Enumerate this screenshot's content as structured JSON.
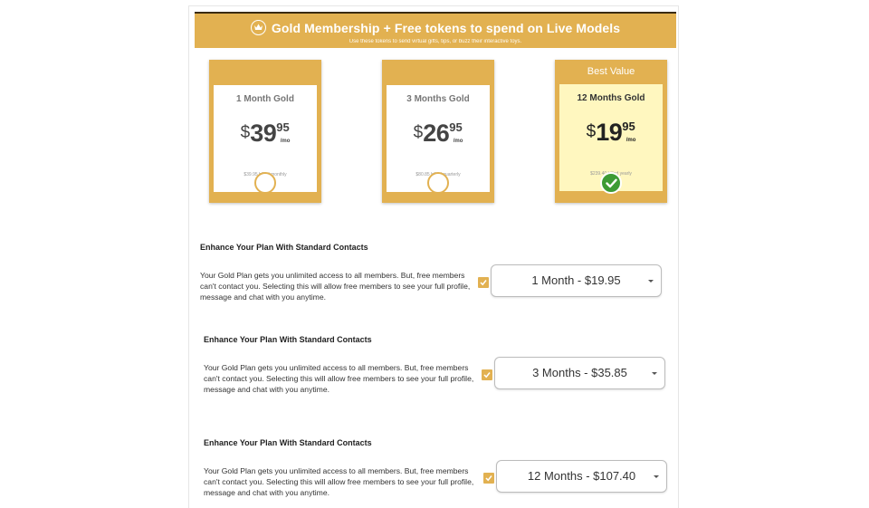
{
  "banner": {
    "title": "Gold Membership + Free tokens to spend on Live Models",
    "subtitle": "Use these tokens to send virtual gifts, tips, or buzz their interactive toys.",
    "icon": "crown-icon",
    "color": "#e2b151"
  },
  "plans": [
    {
      "name": "1 Month Gold",
      "currency": "$",
      "whole": "39",
      "cents": "95",
      "per": "/mo",
      "billed": "$39.95 billed monthly",
      "selected": false
    },
    {
      "name": "3 Months Gold",
      "currency": "$",
      "whole": "26",
      "cents": "95",
      "per": "/mo",
      "billed": "$80.85 billed quarterly",
      "selected": false
    },
    {
      "name": "12 Months Gold",
      "currency": "$",
      "whole": "19",
      "cents": "95",
      "per": "/mo",
      "billed": "$239.40 billed yearly",
      "selected": true,
      "badge": "Best Value"
    }
  ],
  "addons": [
    {
      "title": "Enhance Your Plan With Standard Contacts",
      "description": "Your Gold Plan gets you unlimited access to all members. But, free members can't contact you. Selecting this will allow free members to see your full profile, message and chat with you anytime.",
      "checked": true,
      "selected_option": "1 Month - $19.95"
    },
    {
      "title": "Enhance Your Plan With Standard Contacts",
      "description": "Your Gold Plan gets you unlimited access to all members. But, free members can't contact you. Selecting this will allow free members to see your full profile, message and chat with you anytime.",
      "checked": true,
      "selected_option": "3 Months - $35.85"
    },
    {
      "title": "Enhance Your Plan With Standard Contacts",
      "description": "Your Gold Plan gets you unlimited access to all members. But, free members can't contact you. Selecting this will allow free members to see your full profile, message and chat with you anytime.",
      "checked": true,
      "selected_option": "12 Months - $107.40"
    }
  ],
  "colors": {
    "accent": "#e2b151",
    "best_bg": "#fff7bf",
    "check_green": "#3d9b35"
  }
}
